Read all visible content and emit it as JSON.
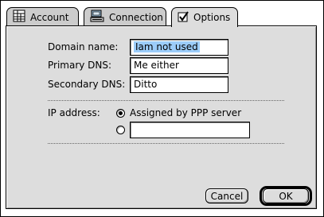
{
  "tabs": [
    {
      "label": "Account",
      "icon": "account-grid-icon",
      "active": false
    },
    {
      "label": "Connection",
      "icon": "connection-icon",
      "active": false
    },
    {
      "label": "Options",
      "icon": "checkbox-icon",
      "active": true
    }
  ],
  "form": {
    "domain_label": "Domain name:",
    "domain_value": "Iam not used",
    "primary_dns_label": "Primary DNS:",
    "primary_dns_value": "Me either",
    "secondary_dns_label": "Secondary DNS:",
    "secondary_dns_value": "Ditto",
    "ip_label": "IP address:",
    "ip_option_assigned": "Assigned by PPP server",
    "ip_manual_value": ""
  },
  "buttons": {
    "cancel": "Cancel",
    "ok": "OK"
  }
}
